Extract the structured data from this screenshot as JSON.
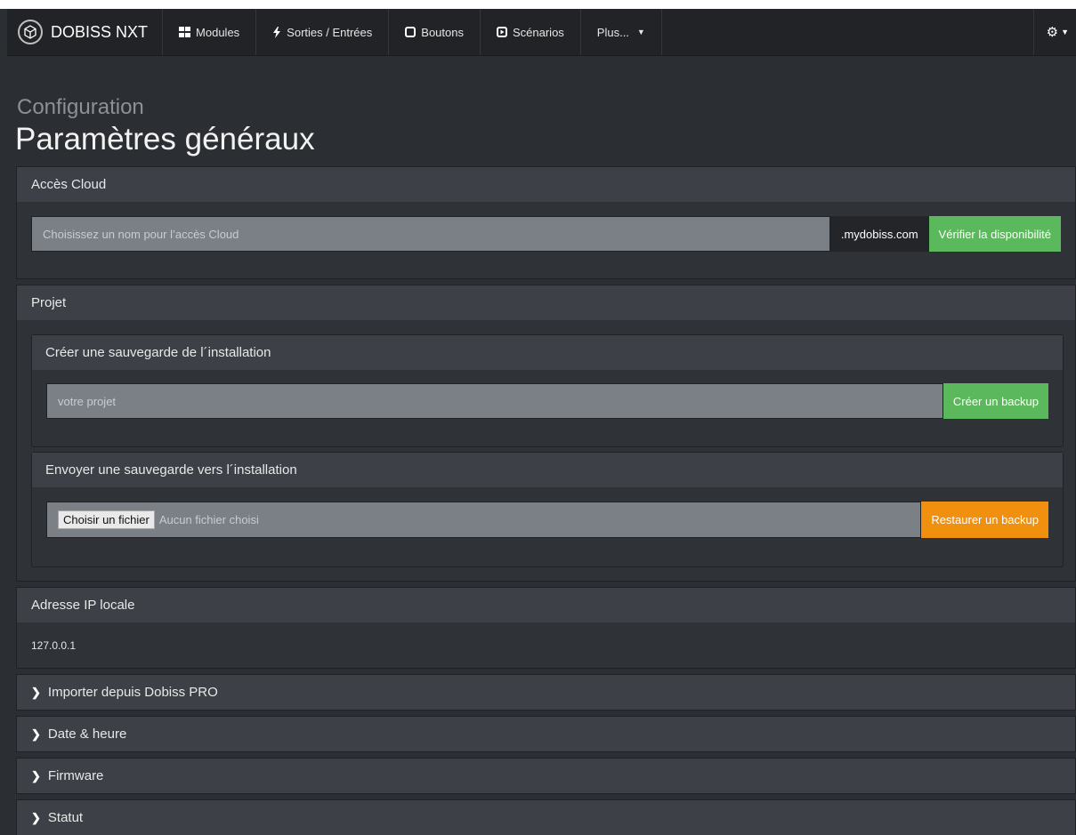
{
  "nav": {
    "brand": "DOBISS NXT",
    "items": [
      {
        "icon": "grid-icon",
        "label": "Modules"
      },
      {
        "icon": "bolt-icon",
        "label": "Sorties / Entrées"
      },
      {
        "icon": "square-icon",
        "label": "Boutons"
      },
      {
        "icon": "play-icon",
        "label": "Scénarios"
      },
      {
        "icon": "",
        "label": "Plus..."
      }
    ],
    "settings_icon": "gear-icon"
  },
  "page": {
    "subtitle": "Configuration",
    "title": "Paramètres généraux"
  },
  "cloud": {
    "heading": "Accès Cloud",
    "placeholder": "Choisissez un nom pour l’accès Cloud",
    "suffix": ".mydobiss.com",
    "check_button": "Vérifier la disponibilité"
  },
  "project": {
    "heading": "Projet",
    "backup": {
      "heading": "Créer une sauvegarde de l´installation",
      "placeholder": "votre projet",
      "button": "Créer un backup"
    },
    "restore": {
      "heading": "Envoyer une sauvegarde vers l´installation",
      "file_button": "Choisir un fichier",
      "file_status": "Aucun fichier choisi",
      "button": "Restaurer un backup"
    }
  },
  "ip": {
    "heading": "Adresse IP locale",
    "value": "127.0.0.1"
  },
  "sections": [
    {
      "label": "Importer depuis Dobiss PRO"
    },
    {
      "label": "Date & heure"
    },
    {
      "label": "Firmware"
    },
    {
      "label": "Statut"
    }
  ],
  "colors": {
    "success": "#5cb85c",
    "warning": "#f0900e",
    "background": "#2b2e33"
  }
}
